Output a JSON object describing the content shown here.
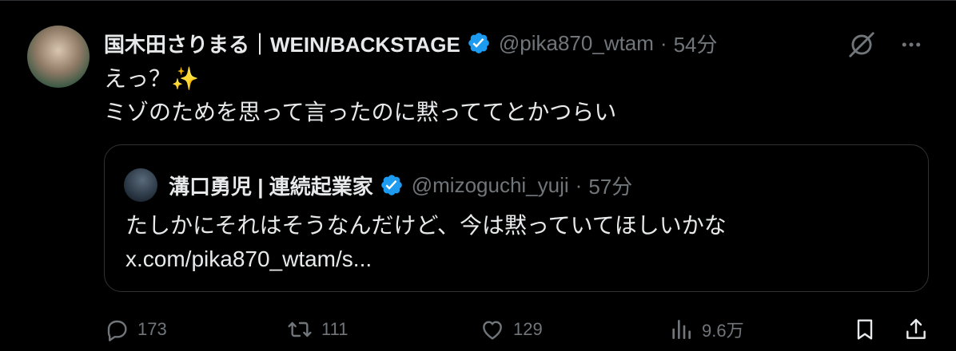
{
  "tweet": {
    "display_name": "国木田さりまる｜WEIN/BACKSTAGE",
    "handle": "@pika870_wtam",
    "separator": "·",
    "time": "54分",
    "text_line1": "えっ？✨",
    "text_line2": "ミゾのためを思って言ったのに黙っててとかつらい"
  },
  "quote": {
    "display_name": "溝口勇児 | 連続起業家",
    "handle": "@mizoguchi_yuji",
    "separator": "·",
    "time": "57分",
    "text_line1": "たしかにそれはそうなんだけど、今は黙っていてほしいかな",
    "text_line2": "x.com/pika870_wtam/s..."
  },
  "actions": {
    "replies": "173",
    "reposts": "111",
    "likes": "129",
    "views": "9.6万"
  },
  "icons": {
    "verified": "verified-badge-icon",
    "grok": "grok-icon",
    "more": "more-icon",
    "reply": "reply-icon",
    "repost": "repost-icon",
    "like": "heart-icon",
    "views": "views-icon",
    "bookmark": "bookmark-icon",
    "share": "share-icon"
  },
  "colors": {
    "background": "#000000",
    "text": "#e7e9ea",
    "secondary": "#71767b",
    "verified": "#1d9bf0",
    "border": "#2f3336"
  }
}
